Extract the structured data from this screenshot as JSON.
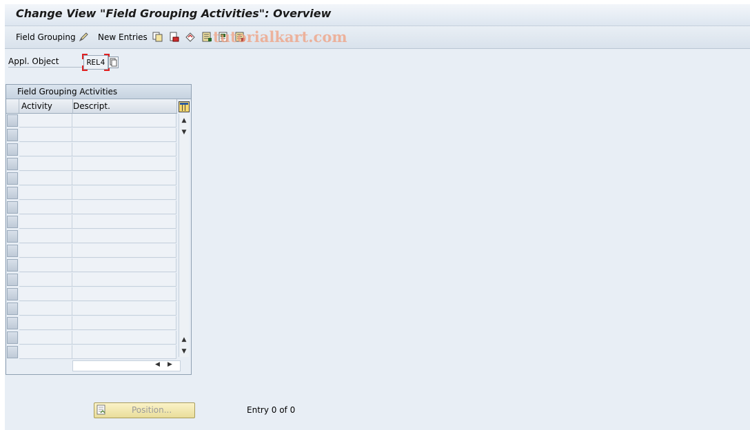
{
  "window": {
    "title": "Change View \"Field Grouping Activities\": Overview"
  },
  "toolbar": {
    "field_grouping_label": "Field Grouping",
    "new_entries_label": "New Entries",
    "icons": [
      "display-change-icon",
      "copy-icon",
      "delete-icon",
      "undo-change-icon",
      "select-all-icon",
      "select-block-icon",
      "deselect-all-icon"
    ]
  },
  "watermark": "tutorialkart.com",
  "selection": {
    "label": "Appl. Object",
    "value": "REL4"
  },
  "table": {
    "title": "Field Grouping Activities",
    "columns": [
      "Activity",
      "Descript."
    ],
    "rows": [
      [
        "",
        ""
      ],
      [
        "",
        ""
      ],
      [
        "",
        ""
      ],
      [
        "",
        ""
      ],
      [
        "",
        ""
      ],
      [
        "",
        ""
      ],
      [
        "",
        ""
      ],
      [
        "",
        ""
      ],
      [
        "",
        ""
      ],
      [
        "",
        ""
      ],
      [
        "",
        ""
      ],
      [
        "",
        ""
      ],
      [
        "",
        ""
      ],
      [
        "",
        ""
      ],
      [
        "",
        ""
      ],
      [
        "",
        ""
      ],
      [
        "",
        ""
      ]
    ]
  },
  "footer": {
    "position_button_label": "Position...",
    "entry_status": "Entry 0 of 0"
  },
  "colors": {
    "background": "#e8eef5",
    "watermark": "#f0a080",
    "required_marker": "#e02020",
    "position_button": "#f3e9b0"
  }
}
